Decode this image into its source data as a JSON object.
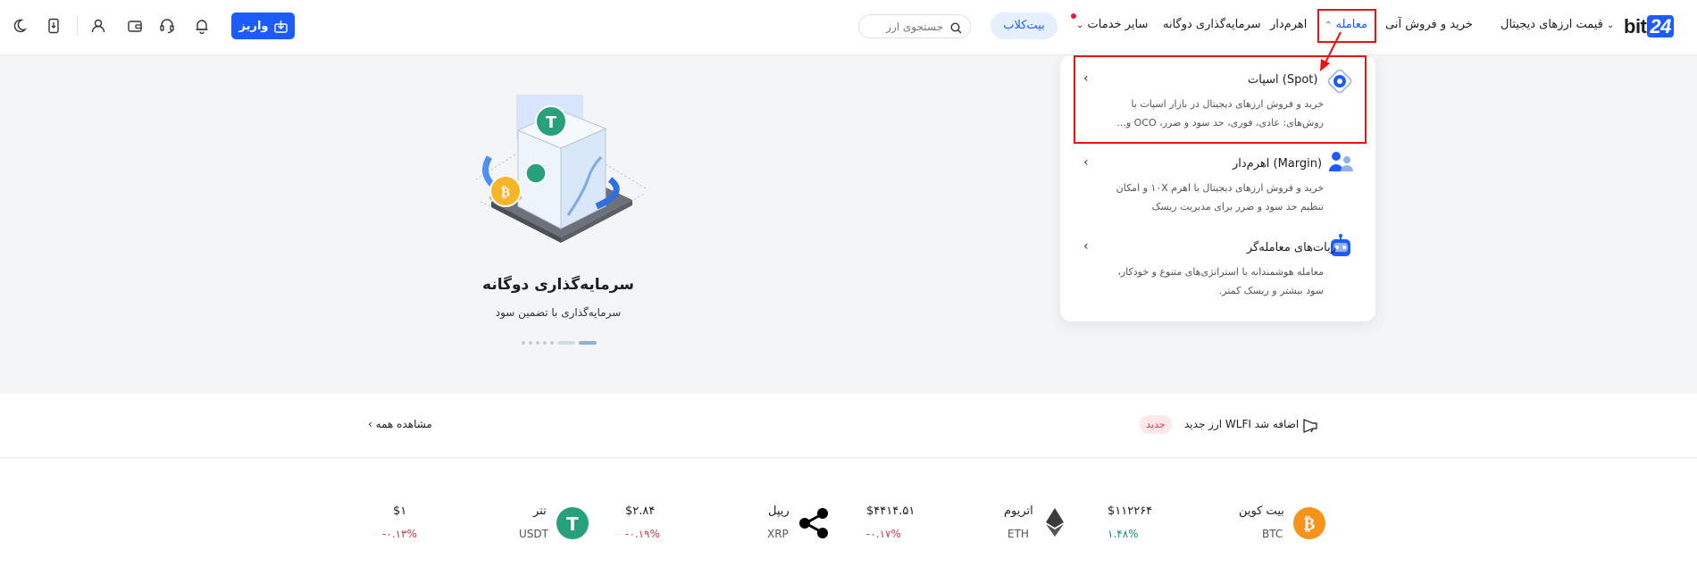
{
  "header": {
    "logo_text": "bit",
    "logo_num": "24",
    "nav": {
      "trade": "معامله",
      "prices": "قیمت ارزهای دیجیتال",
      "instant": "خرید و فروش آنی",
      "leverage": "اهرم‌دار",
      "dual": "سرمایه‌گذاری دوگانه",
      "other": "سایر خدمات"
    },
    "bitclub": "بیت‌کلاب",
    "search_placeholder": "جستجوی ارز",
    "deposit": "واریز"
  },
  "dropdown": {
    "items": [
      {
        "title": "اسپات (Spot)",
        "desc_line1": "خرید و فروش ارزهای دیجیتال در بازار اسپات با",
        "desc_line2": "روش‌های: عادی، فوری، حد سود و ضرر، OCO و...",
        "icon": "spot-icon"
      },
      {
        "title": "اهرم‌دار (Margin)",
        "desc_line1": "خرید و فروش ارزهای دیجیتال با اهرم ۱۰X و امکان",
        "desc_line2": "تنظیم حد سود و ضرر برای مدیریت ریسک",
        "icon": "margin-icon"
      },
      {
        "title": "ربات‌های معامله‌گر",
        "desc_line1": "معامله هوشمندانه با استراتژی‌های متنوع و خودکار،",
        "desc_line2": "سود بیشتر و ریسک کمتر.",
        "icon": "robot-icon"
      }
    ]
  },
  "hero": {
    "title": "سرمایه‌گذاری دوگانه",
    "subtitle": "سرمایه‌گذاری با تضمین سود"
  },
  "announcement": {
    "badge": "جدید",
    "text": "ارز جدید WLFI اضافه شد",
    "view_all": "مشاهده همه"
  },
  "tickers": [
    {
      "name": "بیت کوین",
      "symbol": "BTC",
      "price": "$۱۱۲۲۶۴",
      "change": "۱.۴۸%",
      "direction": "up",
      "color": "#f7931a"
    },
    {
      "name": "اتریوم",
      "symbol": "ETH",
      "price": "$۴۴۱۴.۵۱",
      "change": "-۰.۱۷%",
      "direction": "down",
      "color": "#3c3c3d"
    },
    {
      "name": "ریپل",
      "symbol": "XRP",
      "price": "$۲.۸۴",
      "change": "-۰.۱۹%",
      "direction": "down",
      "color": "#000000"
    },
    {
      "name": "تتر",
      "symbol": "USDT",
      "price": "$۱",
      "change": "-۰.۱۳%",
      "direction": "down",
      "color": "#26a17b"
    }
  ],
  "colors": {
    "accent": "#1c5cff",
    "up": "#0c9a5c",
    "down": "#d23a4a",
    "highlight": "#ee1111"
  }
}
